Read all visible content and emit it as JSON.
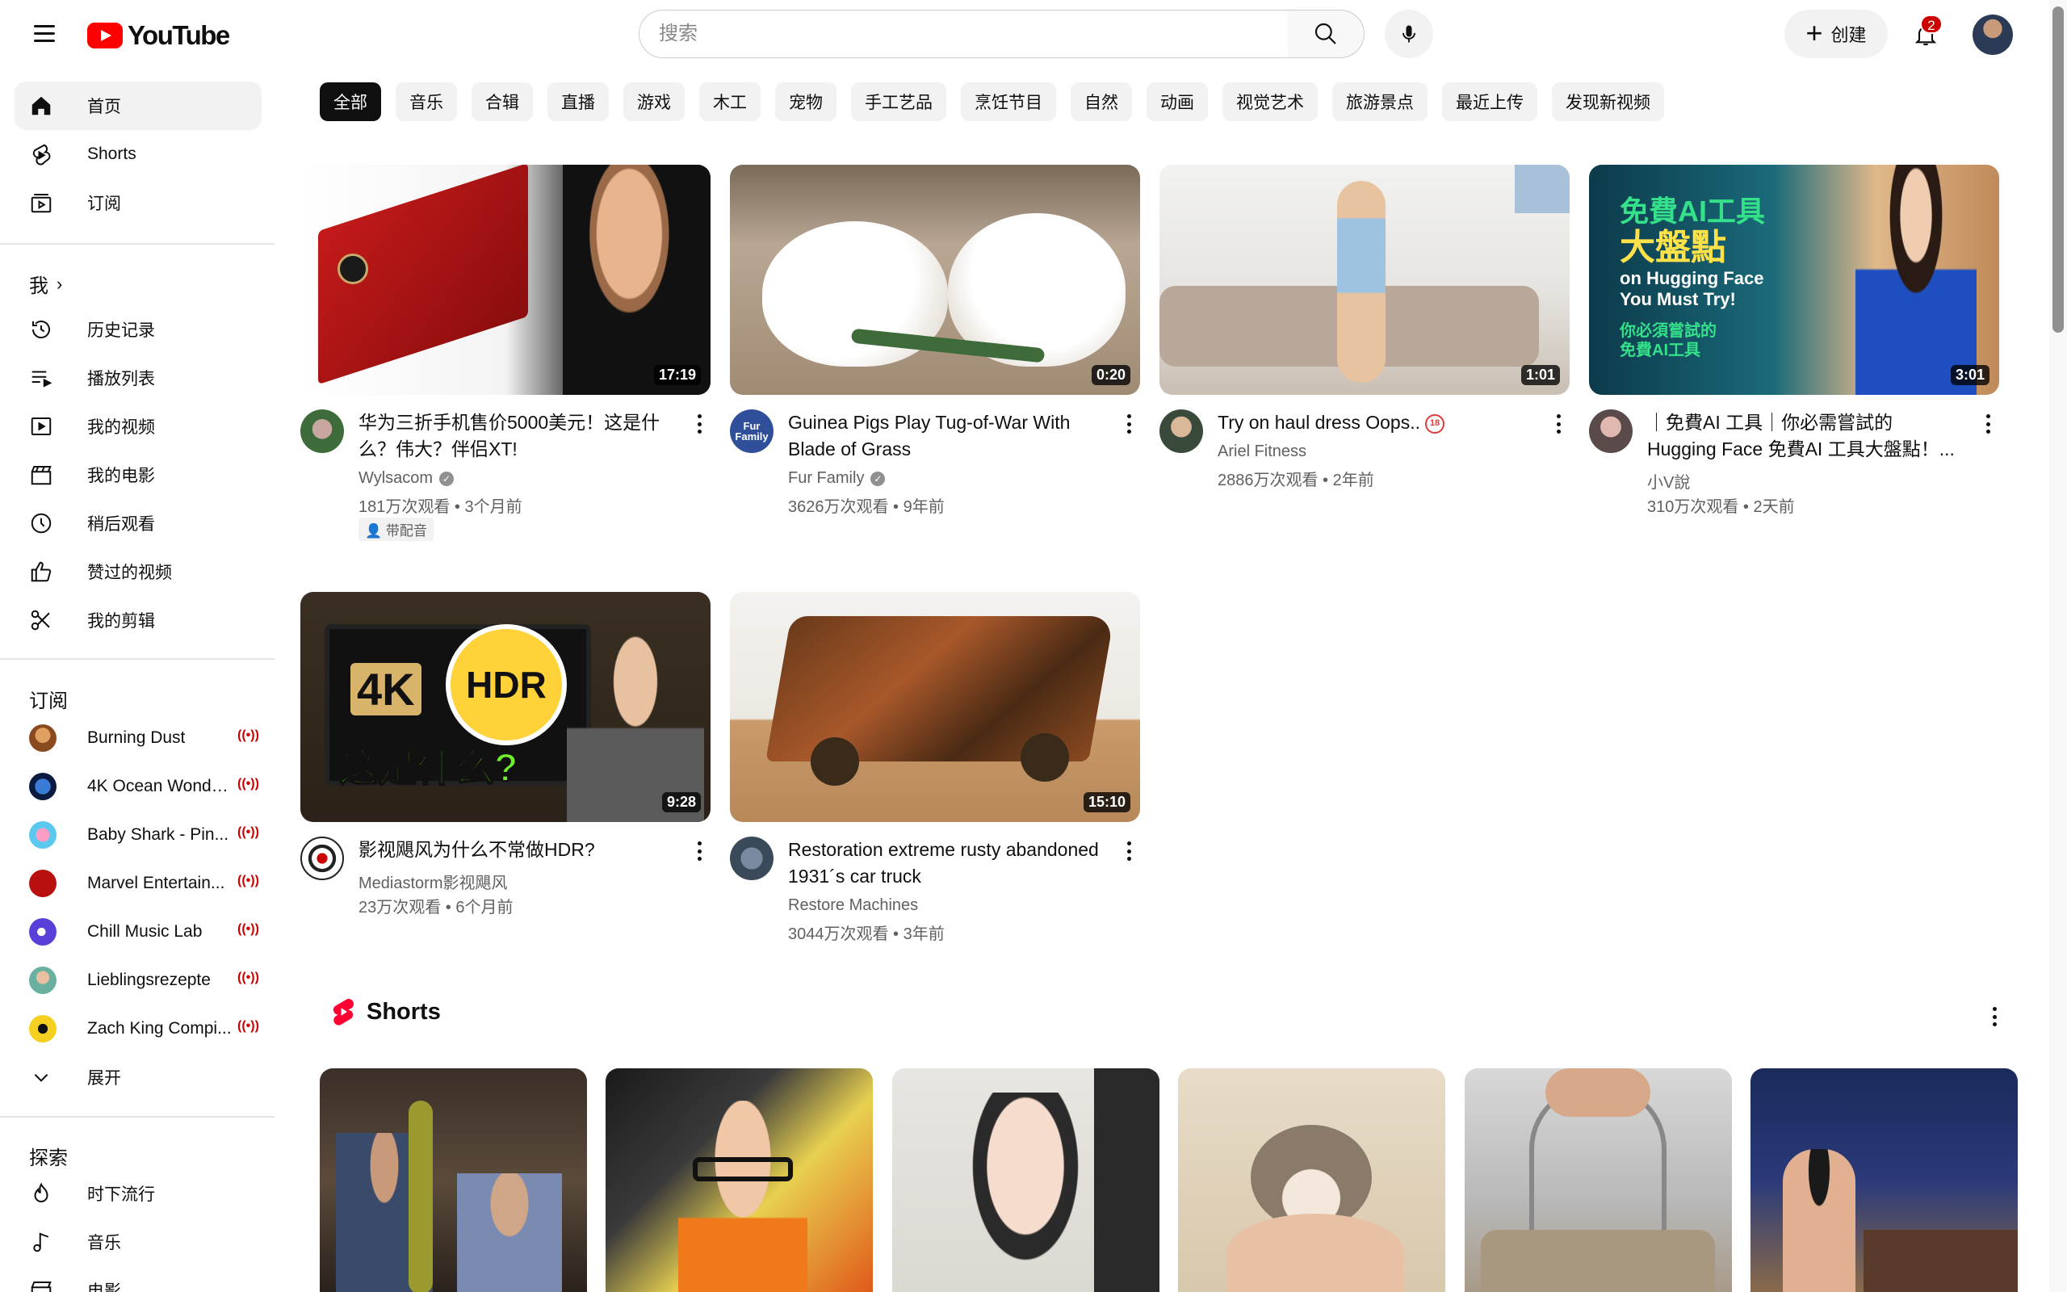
{
  "app": {
    "brand": "YouTube",
    "accent": "#ff0000"
  },
  "search": {
    "placeholder": "搜索"
  },
  "header": {
    "create_label": "创建",
    "notification_count": "2"
  },
  "sidebar": {
    "main": [
      {
        "label": "首页",
        "icon": "home-icon"
      },
      {
        "label": "Shorts",
        "icon": "shorts-icon"
      },
      {
        "label": "订阅",
        "icon": "subscriptions-icon"
      }
    ],
    "me_heading": "我",
    "me": [
      {
        "label": "历史记录",
        "icon": "history-icon"
      },
      {
        "label": "播放列表",
        "icon": "playlist-icon"
      },
      {
        "label": "我的视频",
        "icon": "my-videos-icon"
      },
      {
        "label": "我的电影",
        "icon": "movies-icon"
      },
      {
        "label": "稍后观看",
        "icon": "clock-icon"
      },
      {
        "label": "赞过的视频",
        "icon": "thumb-up-icon"
      },
      {
        "label": "我的剪辑",
        "icon": "scissors-icon"
      }
    ],
    "subs_heading": "订阅",
    "subs": [
      {
        "label": "Burning Dust"
      },
      {
        "label": "4K Ocean Wonde..."
      },
      {
        "label": "Baby Shark - Pin..."
      },
      {
        "label": "Marvel Entertain..."
      },
      {
        "label": "Chill Music Lab"
      },
      {
        "label": "Lieblingsrezepte"
      },
      {
        "label": "Zach King Compi..."
      }
    ],
    "expand_label": "展开",
    "explore_heading": "探索",
    "explore": [
      {
        "label": "时下流行",
        "icon": "trending-icon"
      },
      {
        "label": "音乐",
        "icon": "music-icon"
      },
      {
        "label": "电影",
        "icon": "film-icon"
      }
    ]
  },
  "chips": [
    "全部",
    "音乐",
    "合辑",
    "直播",
    "游戏",
    "木工",
    "宠物",
    "手工艺品",
    "烹饪节目",
    "自然",
    "动画",
    "视觉艺术",
    "旅游景点",
    "最近上传",
    "发现新视频"
  ],
  "videos": [
    {
      "title": "华为三折手机售价5000美元！这是什么？伟大？伴侣XT!",
      "channel": "Wylsacom",
      "verified": true,
      "meta": "181万次观看 • 3个月前",
      "duration": "17:19",
      "badge": "带配音"
    },
    {
      "title": "Guinea Pigs Play Tug-of-War With Blade of Grass",
      "channel": "Fur Family",
      "verified": true,
      "meta": "3626万次观看 • 9年前",
      "duration": "0:20"
    },
    {
      "title": "Try on haul dress Oops..",
      "channel": "Ariel Fitness",
      "verified": false,
      "meta": "2886万次观看 • 2年前",
      "duration": "1:01",
      "age_rating": "18"
    },
    {
      "title": "｜免費AI 工具｜你必需嘗試的 Hugging Face 免費AI 工具大盤點！...",
      "channel": "小V說",
      "verified": false,
      "meta": "310万次观看 • 2天前",
      "duration": "3:01"
    },
    {
      "title": "影视飓风为什么不常做HDR?",
      "channel": "Mediastorm影视飓风",
      "verified": false,
      "meta": "23万次观看 • 6个月前",
      "duration": "9:28"
    },
    {
      "title": "Restoration extreme rusty abandoned 1931´s car truck",
      "channel": "Restore Machines",
      "verified": false,
      "meta": "3044万次观看 • 3年前",
      "duration": "15:10"
    }
  ],
  "thumb_text": {
    "ai": [
      "免費AI工具",
      "大盤點",
      "on Hugging Face",
      "You Must Try!",
      "你必須嘗試的",
      "免費AI工具"
    ],
    "hdr": [
      "4K",
      "HDR",
      "这是什么?"
    ],
    "fur_logo": "Fur Family"
  },
  "shorts": {
    "title": "Shorts",
    "count": 6
  }
}
